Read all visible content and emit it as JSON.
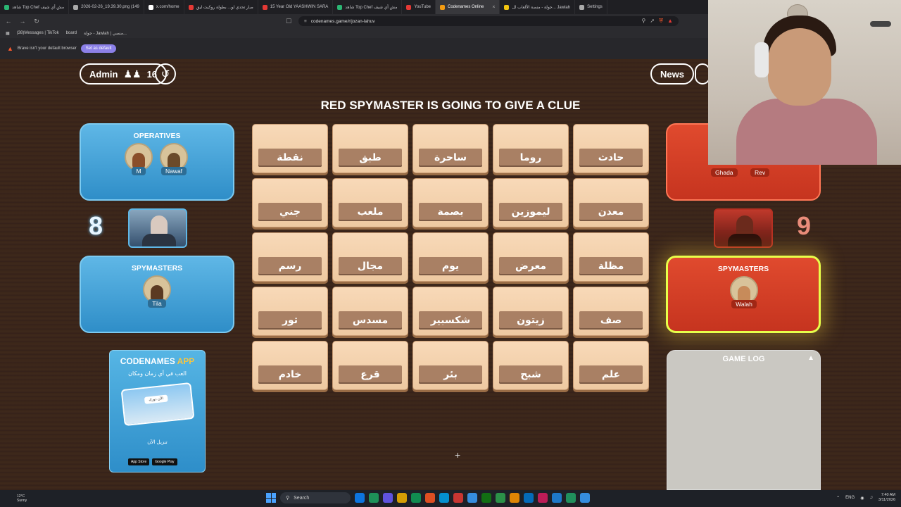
{
  "browser": {
    "tabs": [
      {
        "title": "شاهد Top Chef مش أي شيف",
        "color": "#2bb673"
      },
      {
        "title": "2026-02-26_19.39.30.png (149",
        "color": "#aaaaaa"
      },
      {
        "title": "x.com/home",
        "color": "#ffffff"
      },
      {
        "title": "صار تحدي لو... بطولة روكيت ليق",
        "color": "#e53935"
      },
      {
        "title": "15 Year Old YAASHWIN SARA",
        "color": "#e53935"
      },
      {
        "title": "شاهد Top Chef مش أي شيف",
        "color": "#2bb673"
      },
      {
        "title": "YouTube",
        "color": "#e53935"
      },
      {
        "title": "Codenames Online",
        "color": "#f39c12",
        "active": true
      },
      {
        "title": "جولة - منصة الألعاب ال... Jawlah",
        "color": "#f1c40f"
      },
      {
        "title": "Settings",
        "color": "#aaaaaa"
      }
    ],
    "url": "codenames.game/r/jozan-lahuv",
    "bookmarks": [
      "(38)Messages | TikTok",
      "board",
      "جولة - Jawlah | منصي..."
    ],
    "infobar_text": "Brave isn't your default browser",
    "infobar_button": "Set as default"
  },
  "game": {
    "admin_label": "Admin",
    "player_count": "16",
    "news_label": "News",
    "banner": "RED SPYMASTER IS GOING TO GIVE A CLUE",
    "blue": {
      "score": "8",
      "operatives_title": "OPERATIVES",
      "operatives": [
        "M",
        "Nawaf"
      ],
      "spymasters_title": "SPYMASTERS",
      "spymasters": [
        "Tila"
      ]
    },
    "red": {
      "score": "9",
      "operatives": [
        "Ghada",
        "Rev"
      ],
      "spymasters_title": "SPYMASTERS",
      "spymasters": [
        "Walah"
      ]
    },
    "cards": [
      [
        "نقطة",
        "طبق",
        "ساحرة",
        "روما",
        "حادث"
      ],
      [
        "جني",
        "ملعب",
        "بصمة",
        "ليموزين",
        "معدن"
      ],
      [
        "رسم",
        "مجال",
        "يوم",
        "معرض",
        "مظلة"
      ],
      [
        "ثور",
        "مسدس",
        "شكسبير",
        "زيتون",
        "صف"
      ],
      [
        "خادم",
        "قرع",
        "بئر",
        "شبح",
        "علم"
      ]
    ],
    "app_promo": {
      "title_a": "CODENAMES",
      "title_b": "APP",
      "subtitle": "العب في أي زمان ومكان",
      "phone_text": "الآن دورك",
      "cta": "تنزيل الآن",
      "store1": "App Store",
      "store2": "Google Play"
    },
    "game_log_title": "GAME LOG"
  },
  "taskbar": {
    "weather_temp": "12°C",
    "weather_desc": "Sunny",
    "search": "Search",
    "lang": "ENG",
    "time": "7:40 AM",
    "date": "3/11/2026",
    "app_colors": [
      "#0a84ff",
      "#1fa463",
      "#6b5cff",
      "#f4b400",
      "#0f9d58",
      "#ff5722",
      "#00a4ef",
      "#e53935",
      "#3aa0ff",
      "#107c10",
      "#2ea44f",
      "#ff9800",
      "#0078d4",
      "#d81b60",
      "#1e88e5",
      "#21a366",
      "#3aa0ff"
    ]
  }
}
